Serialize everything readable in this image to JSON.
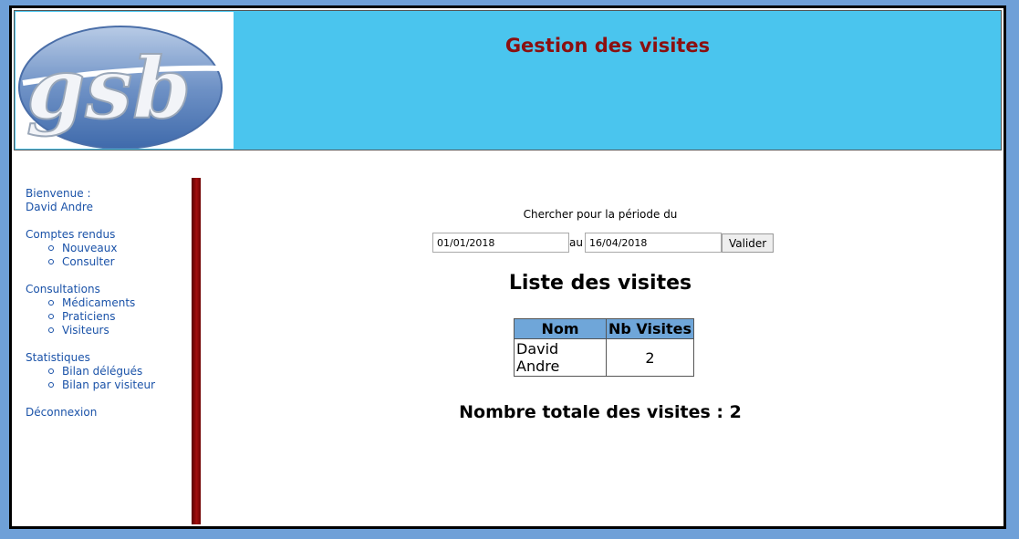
{
  "header": {
    "title": "Gestion des visites",
    "logo_text": "gsb"
  },
  "menu": {
    "welcome_label": "Bienvenue :",
    "user_name": "David Andre",
    "groups": [
      {
        "label": "Comptes rendus",
        "items": [
          "Nouveaux",
          "Consulter"
        ]
      },
      {
        "label": "Consultations",
        "items": [
          "Médicaments",
          "Praticiens",
          "Visiteurs"
        ]
      },
      {
        "label": "Statistiques",
        "items": [
          "Bilan délégués",
          "Bilan par visiteur"
        ]
      }
    ],
    "logout": "Déconnexion"
  },
  "search": {
    "label": "Chercher pour la période du",
    "date_from": "01/01/2018",
    "separator": "au",
    "date_to": "16/04/2018",
    "submit": "Valider"
  },
  "list": {
    "title": "Liste des visites",
    "columns": [
      "Nom",
      "Nb Visites"
    ],
    "rows": [
      {
        "name": "David Andre",
        "count": "2"
      }
    ]
  },
  "total": {
    "text": "Nombre totale des visites : 2"
  }
}
